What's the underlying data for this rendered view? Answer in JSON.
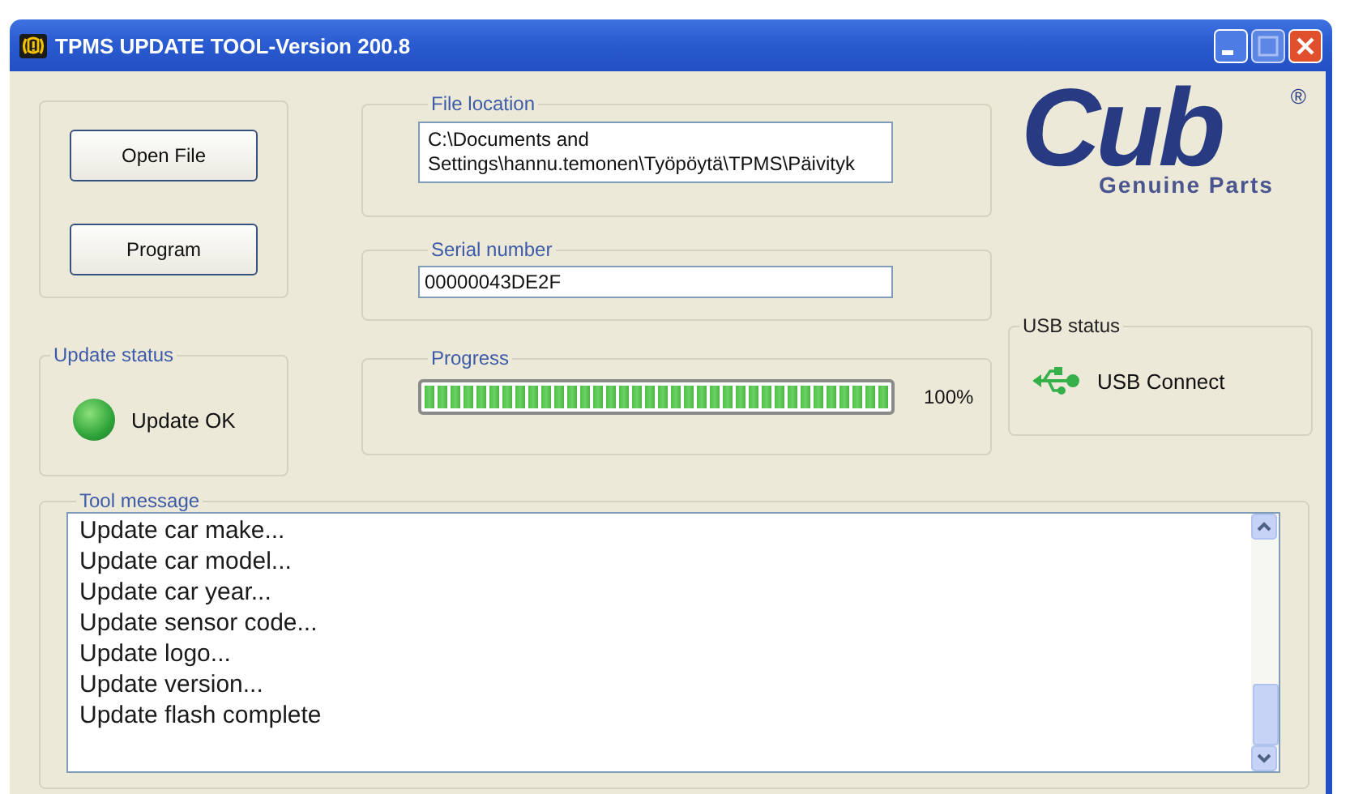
{
  "window": {
    "title": "TPMS UPDATE TOOL-Version 200.8"
  },
  "buttons": [
    {
      "label": "Open File"
    },
    {
      "label": "Program"
    }
  ],
  "file_location": {
    "label": "File location",
    "value": "C:\\Documents and Settings\\hannu.temonen\\Työpöytä\\TPMS\\Päivityk"
  },
  "serial_number": {
    "label": "Serial number",
    "value": "00000043DE2F"
  },
  "logo": {
    "name": "Cub",
    "tagline": "Genuine Parts",
    "mark": "®"
  },
  "update_status": {
    "label": "Update status",
    "text": "Update OK",
    "ok": true
  },
  "progress": {
    "label": "Progress",
    "level": 1.0,
    "reading": "100%"
  },
  "usb_status": {
    "label": "USB status",
    "text": "USB Connect",
    "connected": true
  },
  "tool_message": {
    "label": "Tool message",
    "lines": [
      "Update car make...",
      "Update car model...",
      "Update car year...",
      "Update sensor code...",
      "Update logo...",
      "Update version...",
      "Update flash complete"
    ]
  }
}
